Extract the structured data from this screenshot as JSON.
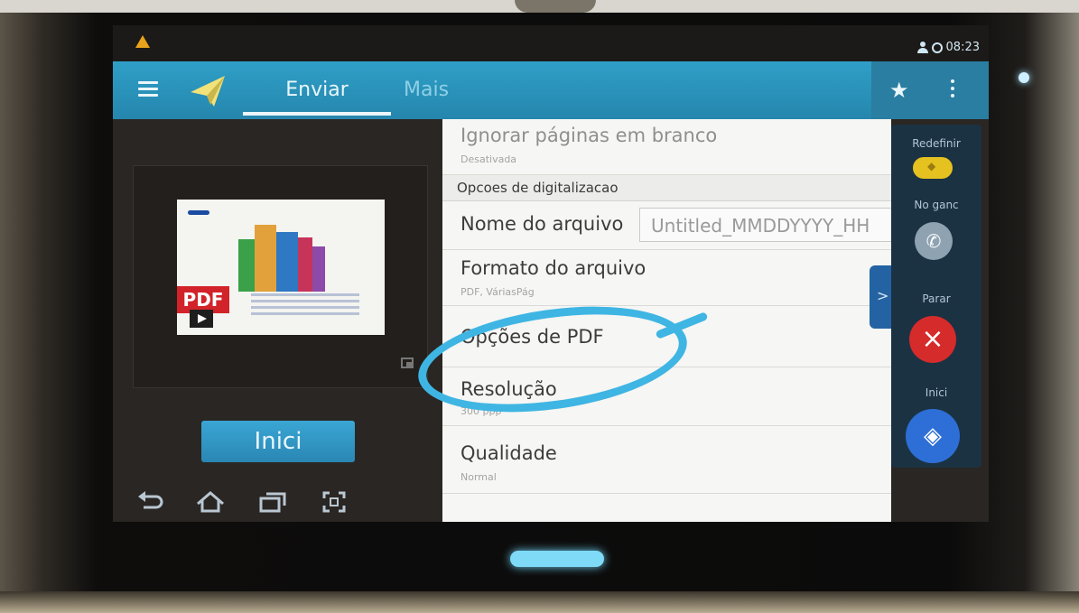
{
  "status_bar": {
    "warning_icon": "warning-icon",
    "time": "08:23"
  },
  "app_bar": {
    "tabs": [
      {
        "label": "Enviar",
        "active": true
      },
      {
        "label": "Mais",
        "active": false
      }
    ],
    "accent_color": "#2f9fc7"
  },
  "preview": {
    "badge": "PDF"
  },
  "primary_button": {
    "label": "Inici"
  },
  "settings": {
    "ignore_blank": {
      "title": "Ignorar páginas em branco",
      "value": "Desativada"
    },
    "section_header": "Opcoes de digitalizacao",
    "file_name": {
      "label": "Nome do arquivo",
      "value": "Untitled_MMDDYYYY_HH"
    },
    "file_format": {
      "title": "Formato do arquivo",
      "value": "PDF, VáriasPág"
    },
    "pdf_options": {
      "title": "Opções de PDF"
    },
    "resolution": {
      "title": "Resolução",
      "value": "300 ppp"
    },
    "quality": {
      "title": "Qualidade",
      "value": "Normal"
    }
  },
  "side_panel": {
    "reset_label": "Redefinir",
    "hook_label": "No ganc",
    "stop_label": "Parar",
    "start_label": "Inici",
    "colors": {
      "reset": "#e5c21f",
      "stop": "#d62b2b",
      "start": "#2d6fd6"
    }
  }
}
